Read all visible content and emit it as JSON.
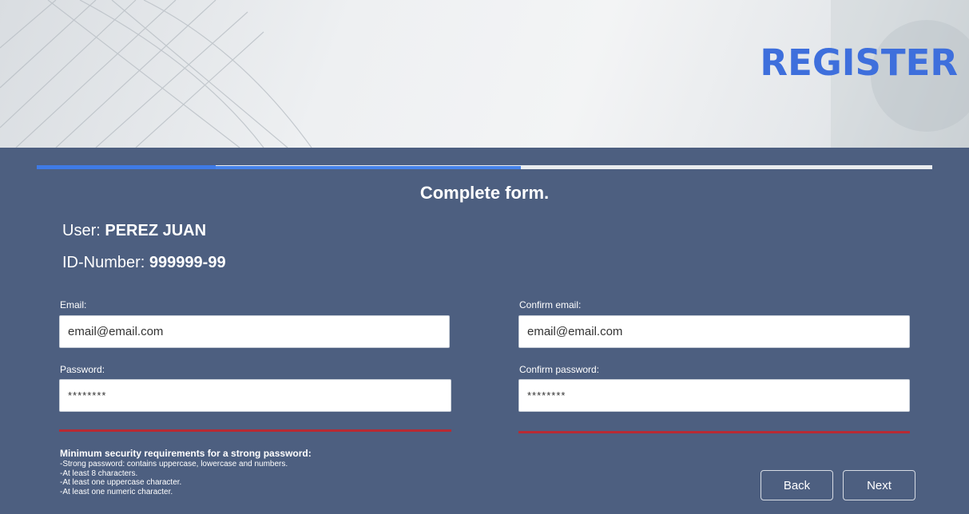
{
  "header": {
    "title": "REGISTER"
  },
  "progress": {
    "completed_fraction": 0.54,
    "step_fraction": 0.2
  },
  "form": {
    "heading": "Complete form.",
    "user_label": "User:",
    "user_value": "PEREZ JUAN",
    "id_label": "ID-Number:",
    "id_value": "999999-99",
    "email": {
      "label": "Email:",
      "value": "email@email.com"
    },
    "confirm_email": {
      "label": "Confirm email:",
      "value": "email@email.com"
    },
    "password": {
      "label": "Password:",
      "value": "********"
    },
    "confirm_password": {
      "label": "Confirm password:",
      "value": "********"
    }
  },
  "requirements": {
    "title": "Minimum security requirements for a strong password:",
    "items": [
      "-Strong password: contains uppercase, lowercase and numbers.",
      "-At least 8 characters.",
      "-At least one uppercase character.",
      "-At least one numeric character."
    ]
  },
  "buttons": {
    "back": "Back",
    "next": "Next"
  },
  "colors": {
    "background": "#4d5f80",
    "accent": "#3e6fdc",
    "progress": "#3f7be6",
    "strength_weak": "#b82a33"
  }
}
